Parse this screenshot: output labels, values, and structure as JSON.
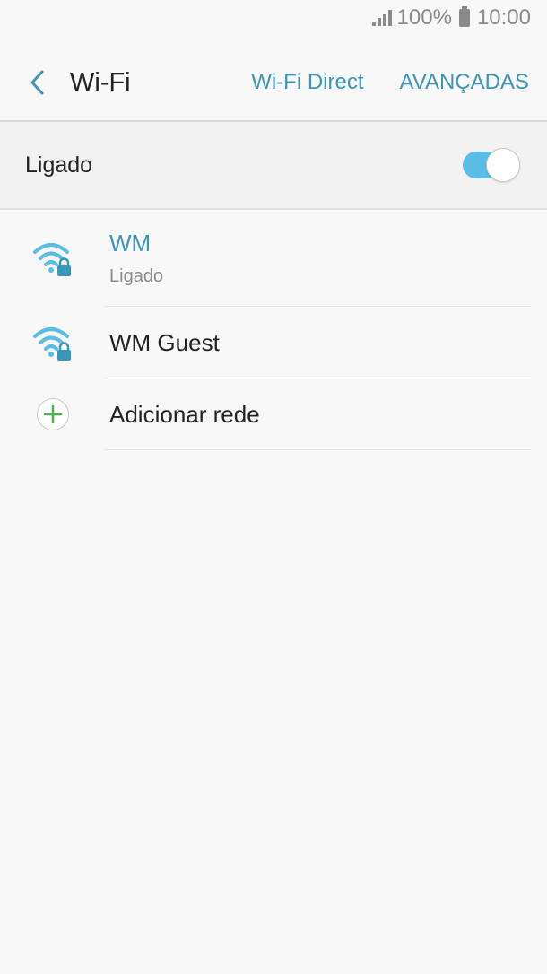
{
  "status_bar": {
    "battery_percent": "100%",
    "time": "10:00"
  },
  "header": {
    "title": "Wi-Fi",
    "actions": [
      "Wi-Fi Direct",
      "AVANÇADAS"
    ]
  },
  "master_switch": {
    "label": "Ligado",
    "state": "on",
    "accent_color": "#5bbde6"
  },
  "networks": [
    {
      "name": "WM",
      "status": "Ligado",
      "secured": true,
      "icon": "wifi-lock-icon"
    },
    {
      "name": "WM Guest",
      "status": "",
      "secured": true,
      "icon": "wifi-lock-icon"
    }
  ],
  "add_network": {
    "label": "Adicionar rede",
    "icon": "plus-circle-icon"
  },
  "colors": {
    "accent": "#3d95b8",
    "add_icon": "#4caf50"
  }
}
